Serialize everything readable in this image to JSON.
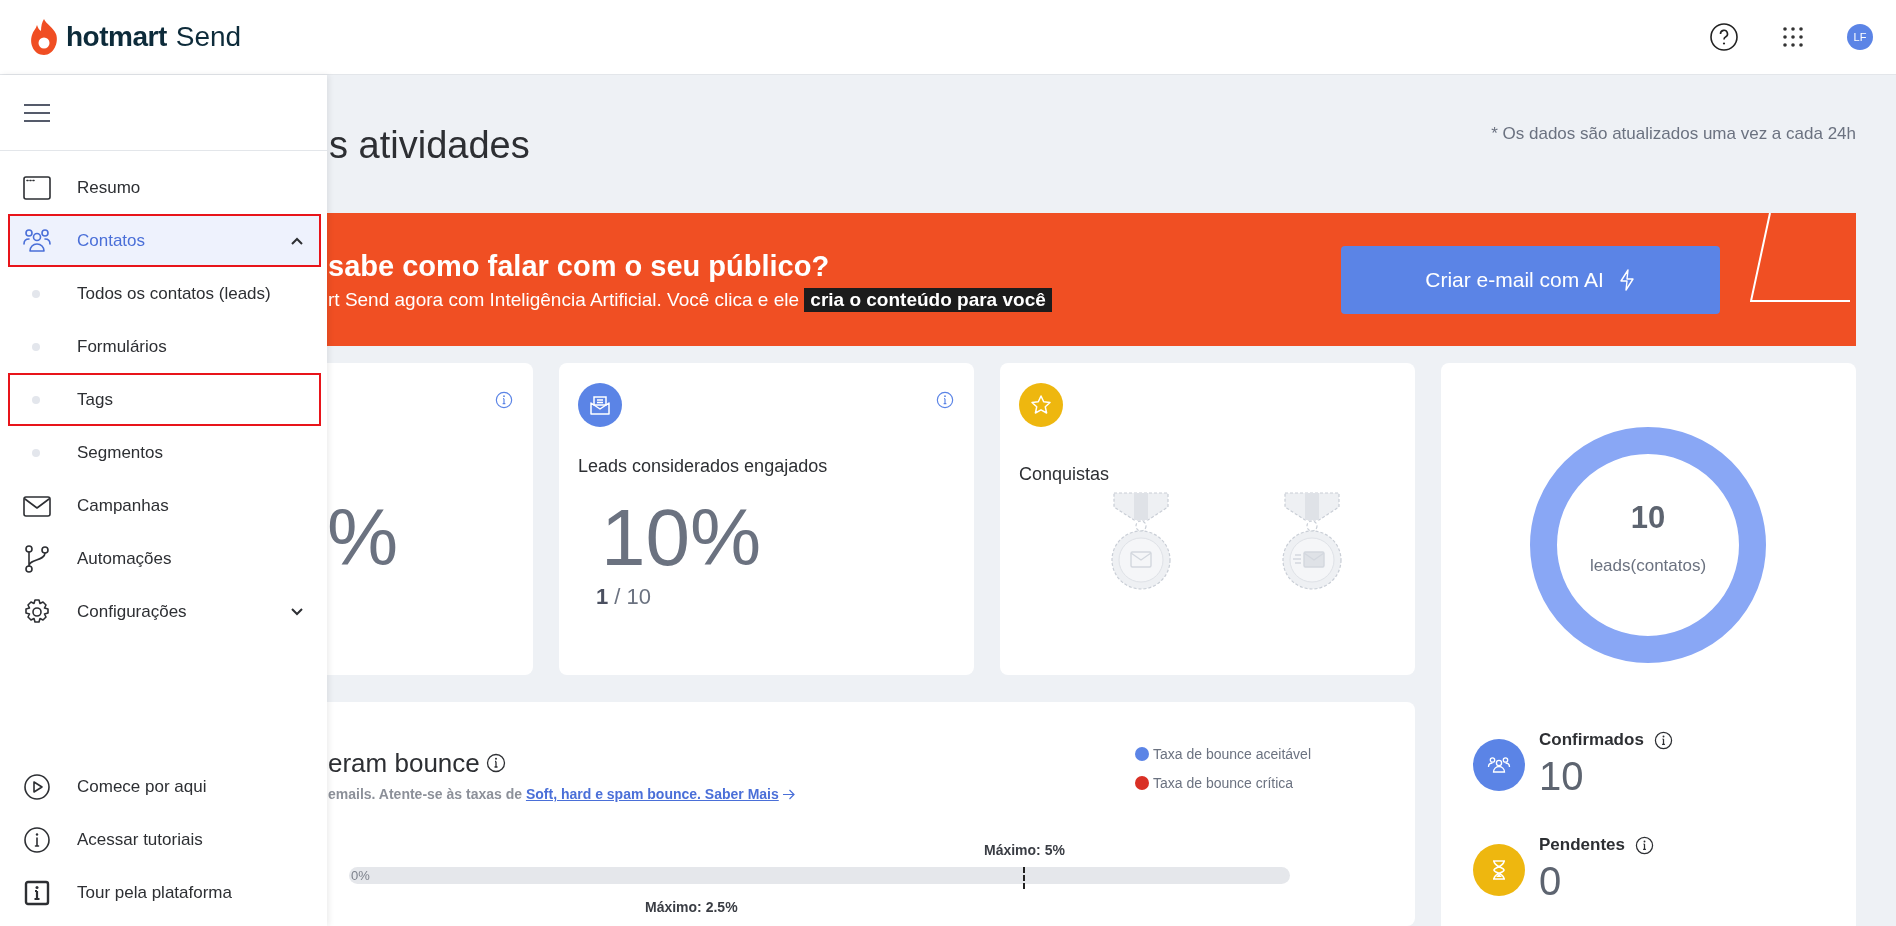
{
  "header": {
    "brand": "hotmart",
    "product": "Send",
    "avatar": "LF"
  },
  "sidebar": {
    "items": [
      {
        "label": "Resumo",
        "selected": false,
        "outlined": false
      },
      {
        "label": "Contatos",
        "selected": true,
        "outlined": true,
        "expanded": true,
        "children": [
          {
            "label": "Todos os contatos (leads)",
            "selected": false,
            "outlined": false
          },
          {
            "label": "Formulários",
            "selected": false,
            "outlined": false
          },
          {
            "label": "Tags",
            "selected": false,
            "outlined": true
          },
          {
            "label": "Segmentos",
            "selected": false,
            "outlined": false
          }
        ]
      },
      {
        "label": "Campanhas",
        "selected": false,
        "outlined": false
      },
      {
        "label": "Automações",
        "selected": false,
        "outlined": false
      },
      {
        "label": "Configurações",
        "selected": false,
        "outlined": false,
        "expanded": false
      }
    ],
    "footer_items": [
      {
        "label": "Comece por aqui"
      },
      {
        "label": "Acessar tutoriais"
      },
      {
        "label": "Tour pela plataforma"
      }
    ]
  },
  "page": {
    "title": "s atividades",
    "note": "* Os dados são atualizados uma vez a cada 24h"
  },
  "banner": {
    "headline": "sabe como falar com o seu público?",
    "text": "rt Send agora com Inteligência Artificial. Você clica e ele",
    "highlight": "cria o conteúdo para você",
    "button": "Criar e-mail com AI"
  },
  "cards": [
    {
      "kind": "metric",
      "info": true,
      "value": "%"
    },
    {
      "kind": "metric",
      "info": true,
      "label": "Leads considerados engajados",
      "value": "10%",
      "count": "**1** / 10"
    },
    {
      "kind": "achievements",
      "info": false,
      "label": "Conquistas"
    }
  ],
  "leads": {
    "total": "10",
    "total_label": "leads(contatos)",
    "stats": [
      {
        "label": "Confirmados",
        "value": "10",
        "color": "#5b84e6"
      },
      {
        "label": "Pendentes",
        "value": "0",
        "color": "#eeb70f"
      }
    ]
  },
  "bounce": {
    "title": "eram bounce",
    "text": "emails. Atente-se às taxas de",
    "link": "Soft, hard e spam bounce. Saber Mais",
    "legend": [
      {
        "label": "Taxa de bounce aceitável",
        "color": "#5b84e6"
      },
      {
        "label": "Taxa de bounce crítica",
        "color": "#d93025"
      }
    ],
    "bar": {
      "limit": "Máximo: 5%",
      "reading": "0%",
      "level": 0
    },
    "next_limit": "Máximo: 2.5%"
  }
}
